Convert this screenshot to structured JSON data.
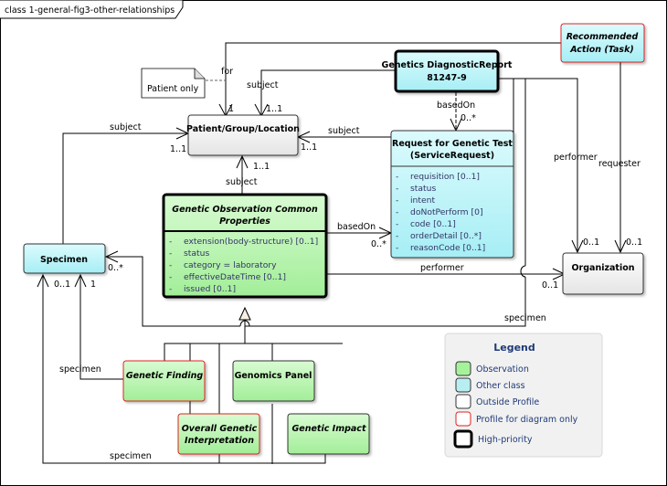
{
  "diagram": {
    "title": "class 1-general-fig3-other-relationships",
    "colors": {
      "observation": "#a8f0a0",
      "other_class": "#b8f2f6",
      "outside_profile": "#f4f4f4",
      "profile_border": "#e02020",
      "legend_text": "#1f3a78"
    },
    "classes": {
      "patient": {
        "name": "Patient/Group/Location"
      },
      "report": {
        "name_line1": "Genetics DiagnosticReport",
        "name_line2": "81247-9"
      },
      "recommended": {
        "name_line1": "Recommended",
        "name_line2": "Action (Task)"
      },
      "request": {
        "name_line1": "Request for Genetic Test",
        "name_line2": "(ServiceRequest)",
        "attributes": [
          "requisition [0..1]",
          "status",
          "intent",
          "doNotPerform [0]",
          "code [0..1]",
          "orderDetail [0..*]",
          "reasonCode [0..1]"
        ]
      },
      "observation": {
        "name_line1": "Genetic Observation Common",
        "name_line2": "Properties",
        "attributes": [
          "extension(body-structure) [0..1]",
          "status",
          "category = laboratory",
          "effectiveDateTime [0..1]",
          "issued [0..1]"
        ]
      },
      "specimen": {
        "name": "Specimen"
      },
      "organization": {
        "name": "Organization"
      },
      "finding": {
        "name": "Genetic Finding"
      },
      "panel": {
        "name": "Genomics Panel"
      },
      "interpretation": {
        "name_line1": "Overall Genetic",
        "name_line2": "Interpretation"
      },
      "impact": {
        "name": "Genetic Impact"
      }
    },
    "note": {
      "text": "Patient only"
    },
    "labels": {
      "for": "for",
      "report_subject": "subject",
      "report_subject_mult": "1..1",
      "for_mult": "1",
      "specimen_subject": "subject",
      "specimen_subject_mult": "1..1",
      "request_subject": "subject",
      "request_subject_mult": "1..1",
      "obs_subject": "subject",
      "obs_subject_mult": "1..1",
      "report_basedOn": "basedOn",
      "report_basedOn_mult": "0..*",
      "obs_basedOn": "basedOn",
      "obs_basedOn_mult": "0..*",
      "performer_task": "performer",
      "requester_task": "requester",
      "performer_task_mult": "0..1",
      "requester_task_mult": "0..1",
      "obs_performer": "performer",
      "obs_performer_mult": "0..1",
      "specimen_right": "specimen",
      "specimen_right_mult": "0..*",
      "specimen_finding": "specimen",
      "specimen_finding_mult": "1",
      "specimen_bottom": "specimen",
      "specimen_bottom_mult": "0..1"
    },
    "legend": {
      "title": "Legend",
      "items": [
        {
          "label": "Observation"
        },
        {
          "label": "Other class"
        },
        {
          "label": "Outside Profile"
        },
        {
          "label": "Profile for diagram only"
        },
        {
          "label": "High-priority"
        }
      ]
    }
  }
}
